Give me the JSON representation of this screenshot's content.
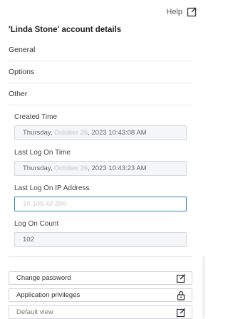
{
  "header": {
    "help_label": "Help",
    "title": "'Linda Stone' account details"
  },
  "sections": [
    "General",
    "Options",
    "Other"
  ],
  "fields": {
    "created_time": {
      "label": "Created Time",
      "value_prefix": "Thursday, ",
      "value_blurred": "October 26",
      "value_suffix": ", 2023 10:43:08 AM"
    },
    "last_logon_time": {
      "label": "Last Log On Time",
      "value_prefix": "Thursday, ",
      "value_blurred": "October 26",
      "value_suffix": ", 2023 10:43:23 AM"
    },
    "last_logon_ip": {
      "label": "Last Log On IP Address",
      "value": "10.100.42.200"
    },
    "logon_count": {
      "label": "Log On Count",
      "value": "102"
    }
  },
  "actions": {
    "change_password": "Change password",
    "app_privileges": "Application privileges",
    "default_view": "Default view"
  },
  "icons": {
    "help": "external-link-icon",
    "change_password": "edit-icon",
    "app_privileges": "lock-icon",
    "default_view": "edit-icon"
  },
  "colors": {
    "accent": "#2f8ac7"
  }
}
